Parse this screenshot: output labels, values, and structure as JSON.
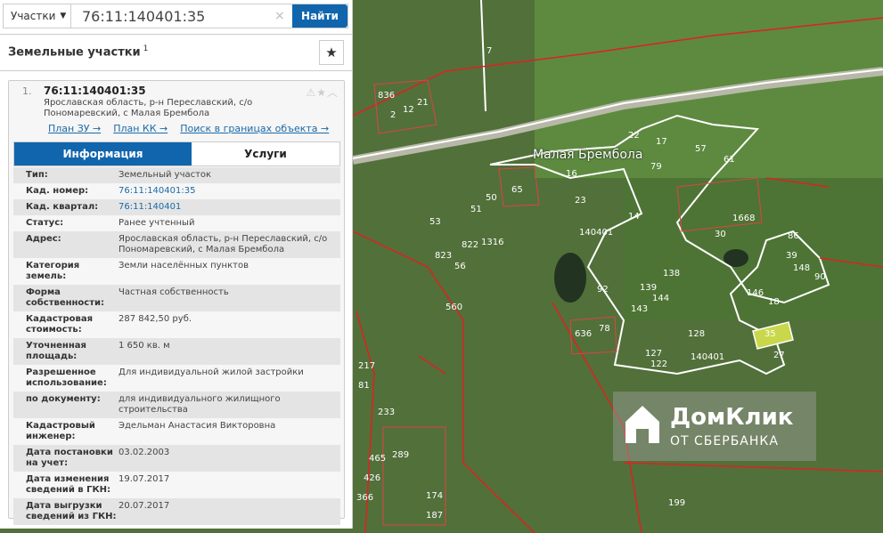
{
  "search": {
    "type": "Участки",
    "value": "76:11:140401:35",
    "clear": "×",
    "submit": "Найти"
  },
  "results": {
    "title": "Земельные участки",
    "count": "1",
    "star": "★"
  },
  "card": {
    "index": "1.",
    "cad_number": "76:11:140401:35",
    "address": "Ярославская область, р-н Переславский, с/о Пономаревский, с Малая Брембола",
    "icons": "⚠★︿",
    "links": [
      "План ЗУ →",
      "План КК →",
      "Поиск в границах объекта →"
    ],
    "tabs": [
      "Информация",
      "Услуги"
    ],
    "rows": [
      {
        "k": "Тип:",
        "v": "Земельный участок"
      },
      {
        "k": "Кад. номер:",
        "v": "76:11:140401:35"
      },
      {
        "k": "Кад. квартал:",
        "v": "76:11:140401"
      },
      {
        "k": "Статус:",
        "v": "Ранее учтенный"
      },
      {
        "k": "Адрес:",
        "v": "Ярославская область, р-н Переславский, с/о Пономаревский, с Малая Брембола"
      },
      {
        "k": "Категория земель:",
        "v": "Земли населённых пунктов"
      },
      {
        "k": "Форма собственности:",
        "v": "Частная собственность"
      },
      {
        "k": "Кадастровая стоимость:",
        "v": "287 842,50 руб."
      },
      {
        "k": "Уточненная площадь:",
        "v": "1 650 кв. м"
      },
      {
        "k": "Разрешенное использование:",
        "v": "Для индивидуальной жилой застройки"
      },
      {
        "k": "по документу:",
        "v": "для индивидуального жилищного строительства"
      },
      {
        "k": "Кадастровый инженер:",
        "v": "Эдельман Анастасия Викторовна"
      },
      {
        "k": "Дата постановки на учет:",
        "v": "03.02.2003"
      },
      {
        "k": "Дата изменения сведений в ГКН:",
        "v": "19.07.2017"
      },
      {
        "k": "Дата выгрузки сведений из ГКН:",
        "v": "20.07.2017"
      }
    ]
  },
  "map": {
    "village": "Малая Брембола",
    "quarter": "140401",
    "parcels": [
      "16",
      "23",
      "14",
      "50",
      "51",
      "53",
      "822",
      "823",
      "56",
      "1316",
      "560",
      "636",
      "78",
      "127",
      "122",
      "128",
      "27",
      "35",
      "146",
      "18",
      "90",
      "148",
      "39",
      "86",
      "30",
      "1668",
      "61",
      "57",
      "79",
      "17",
      "22",
      "65",
      "139",
      "144",
      "138",
      "143",
      "92",
      "217",
      "81",
      "233",
      "465",
      "289",
      "426",
      "366",
      "174",
      "187",
      "199",
      "7",
      "836",
      "21",
      "2",
      "12"
    ],
    "watermark": {
      "brand": "ДомКлик",
      "sub": "ОТ СБЕРБАНКА"
    }
  }
}
